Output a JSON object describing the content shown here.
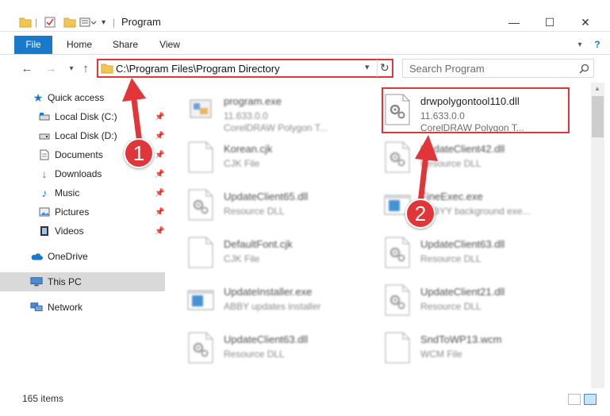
{
  "window": {
    "title": "Program",
    "minimize_glyph": "—",
    "maximize_glyph": "☐",
    "close_glyph": "✕"
  },
  "ribbon": {
    "tabs": [
      "File",
      "Home",
      "Share",
      "View"
    ]
  },
  "address": {
    "path": "C:\\Program Files\\Program Directory",
    "search_placeholder": "Search Program"
  },
  "sidebar": {
    "items": [
      {
        "label": "Quick access",
        "icon": "star-icon",
        "pinned": false
      },
      {
        "label": "Local Disk (C:)",
        "icon": "drive-icon",
        "pinned": true
      },
      {
        "label": "Local Disk (D:)",
        "icon": "drive-icon",
        "pinned": true
      },
      {
        "label": "Documents",
        "icon": "documents-icon",
        "pinned": true
      },
      {
        "label": "Downloads",
        "icon": "download-icon",
        "pinned": true
      },
      {
        "label": "Music",
        "icon": "music-icon",
        "pinned": true
      },
      {
        "label": "Pictures",
        "icon": "pictures-icon",
        "pinned": true
      },
      {
        "label": "Videos",
        "icon": "videos-icon",
        "pinned": true
      },
      {
        "label": "OneDrive",
        "icon": "cloud-icon",
        "pinned": false
      },
      {
        "label": "This PC",
        "icon": "computer-icon",
        "pinned": false
      },
      {
        "label": "Network",
        "icon": "network-icon",
        "pinned": false
      }
    ]
  },
  "files": [
    {
      "name": "program.exe",
      "line1": "11.633.0.0",
      "line2": "CorelDRAW Polygon T...",
      "icon": "exe-icon"
    },
    {
      "name": "drwpolygontool110.dll",
      "line1": "11.633.0.0",
      "line2": "CorelDRAW Polygon T...",
      "icon": "dll-icon"
    },
    {
      "name": "Korean.cjk",
      "line1": "CJK File",
      "line2": "",
      "icon": "file-icon"
    },
    {
      "name": "UpdateClient42.dll",
      "line1": "Resource DLL",
      "line2": "",
      "icon": "dll-icon"
    },
    {
      "name": "UpdateClient65.dll",
      "line1": "Resource DLL",
      "line2": "",
      "icon": "dll-icon"
    },
    {
      "name": "FineExec.exe",
      "line1": "ABBYY background exe...",
      "line2": "",
      "icon": "exe-blue-icon"
    },
    {
      "name": "DefaultFont.cjk",
      "line1": "CJK File",
      "line2": "",
      "icon": "file-icon"
    },
    {
      "name": "UpdateClient63.dll",
      "line1": "Resource DLL",
      "line2": "",
      "icon": "dll-icon"
    },
    {
      "name": "UpdateInstaller.exe",
      "line1": "ABBY updates installer",
      "line2": "",
      "icon": "exe-blue-icon"
    },
    {
      "name": "UpdateClient21.dll",
      "line1": "Resource DLL",
      "line2": "",
      "icon": "dll-icon"
    },
    {
      "name": "UpdateClient63.dll",
      "line1": "Resource DLL",
      "line2": "",
      "icon": "dll-icon"
    },
    {
      "name": "SndToWP13.wcm",
      "line1": "WCM File",
      "line2": "",
      "icon": "file-icon"
    }
  ],
  "status": {
    "item_count": "165 items"
  },
  "annotations": {
    "badge1": "1",
    "badge2": "2",
    "color": "#e0363a"
  }
}
